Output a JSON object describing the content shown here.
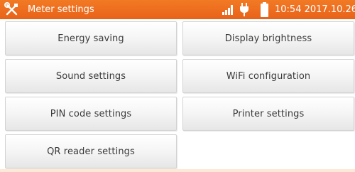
{
  "header": {
    "title": "Meter settings",
    "datetime": "10:54 2017.10.26",
    "icons": [
      "tools-icon",
      "signal-icon",
      "plug-icon",
      "battery-icon"
    ],
    "accent_color": "#ee6a1f"
  },
  "menu": {
    "items": [
      {
        "label": "Energy saving"
      },
      {
        "label": "Display brightness"
      },
      {
        "label": "Sound settings"
      },
      {
        "label": "WiFi configuration"
      },
      {
        "label": "PIN code settings"
      },
      {
        "label": "Printer settings"
      },
      {
        "label": "QR reader settings"
      }
    ]
  }
}
